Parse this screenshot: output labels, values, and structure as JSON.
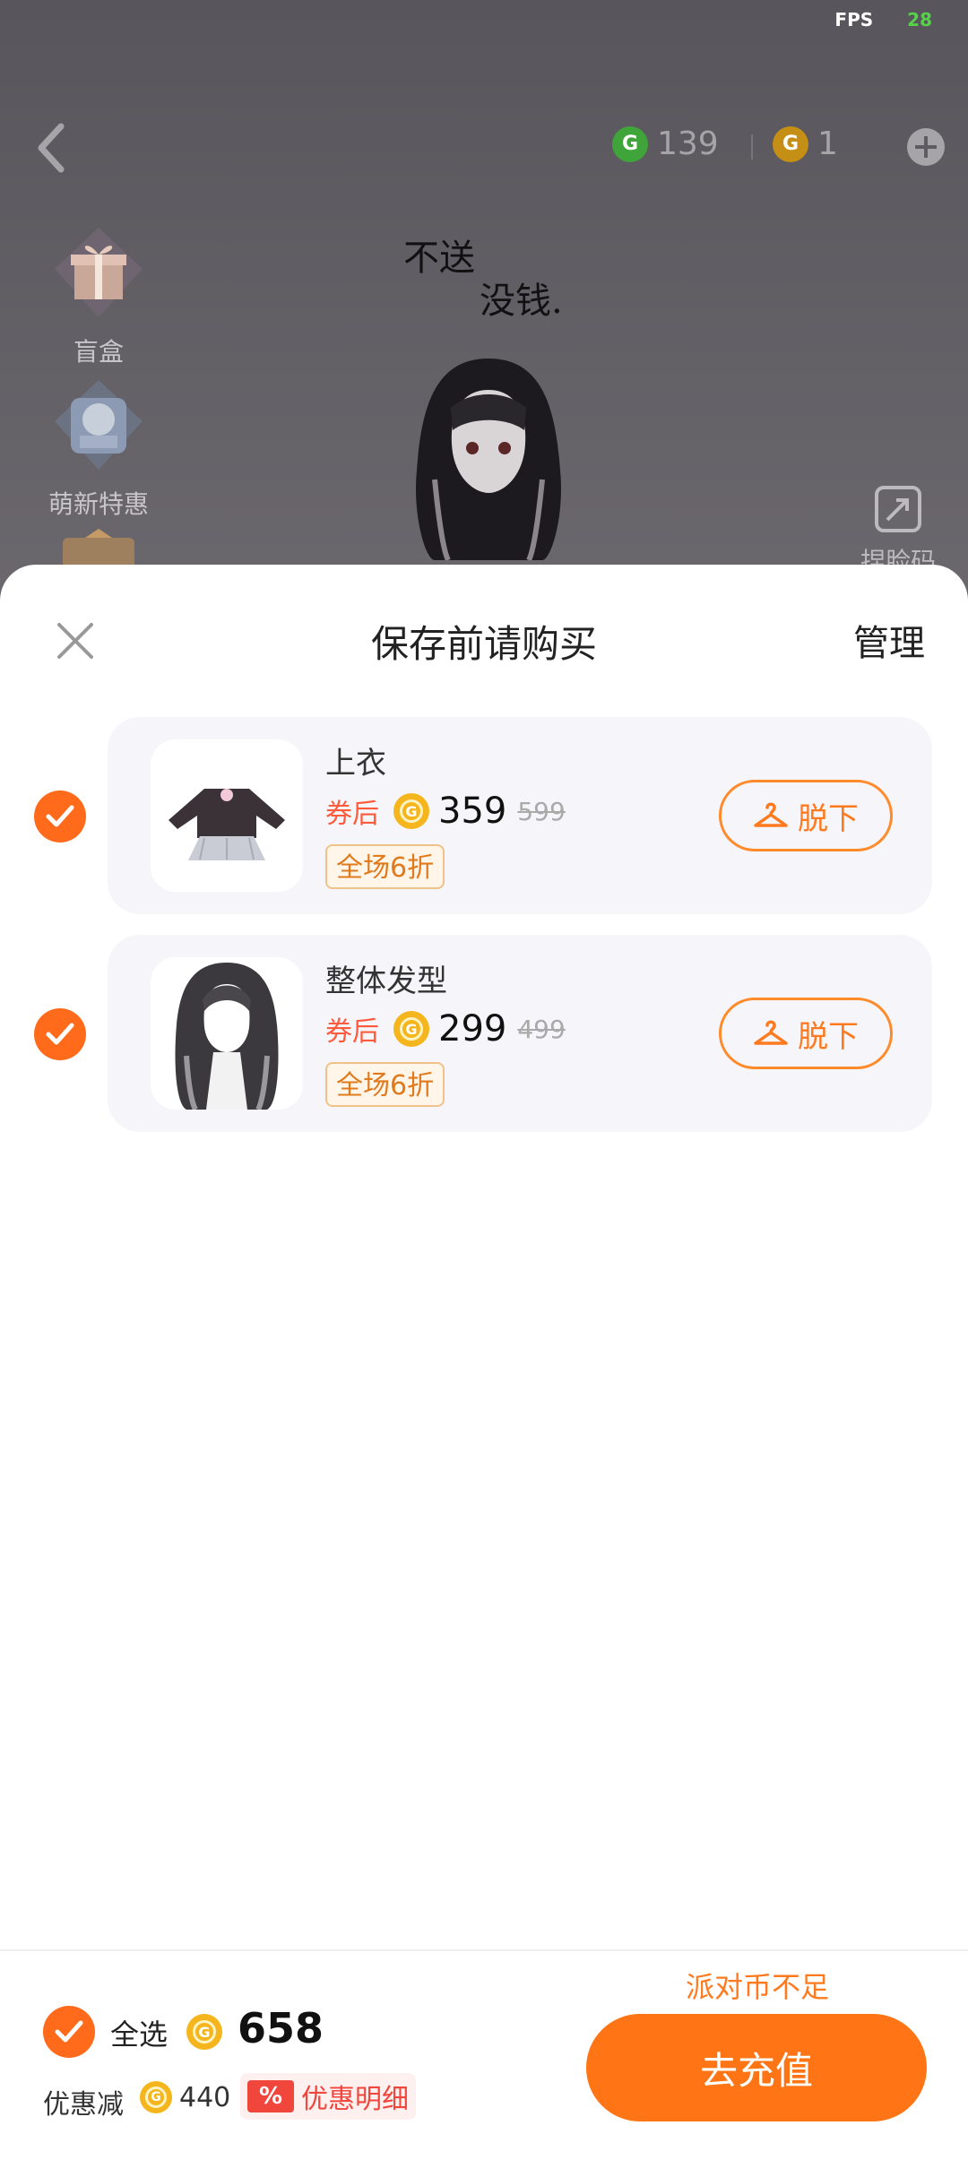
{
  "status": {
    "fps_label": "FPS",
    "fps_value": "28"
  },
  "header": {
    "green_coins": "139",
    "gold_coins": "1"
  },
  "sidebar": {
    "items": [
      {
        "label": "盲盒"
      },
      {
        "label": "萌新特惠"
      }
    ]
  },
  "scene": {
    "doodle_line1": "不送",
    "doodle_line2": "没钱.",
    "face_code_label": "捏脸码"
  },
  "sheet": {
    "title": "保存前请购买",
    "manage_label": "管理",
    "items": [
      {
        "name": "上衣",
        "after_label": "券后",
        "price": "359",
        "original_price": "599",
        "badge": "全场6折",
        "remove_label": "脱下",
        "checked": true
      },
      {
        "name": "整体发型",
        "after_label": "券后",
        "price": "299",
        "original_price": "499",
        "badge": "全场6折",
        "remove_label": "脱下",
        "checked": true
      }
    ]
  },
  "footer": {
    "insufficient_text": "派对币不足",
    "select_all_label": "全选",
    "total_price": "658",
    "discount_label": "优惠减",
    "discount_amount": "440",
    "discount_percent_icon": "%",
    "discount_detail_label": "优惠明细",
    "recharge_label": "去充值"
  },
  "colors": {
    "accent": "#ff7414",
    "price_red": "#ff5a3c",
    "coin_gold": "#f5b51c",
    "coin_green": "#3fa43a"
  }
}
